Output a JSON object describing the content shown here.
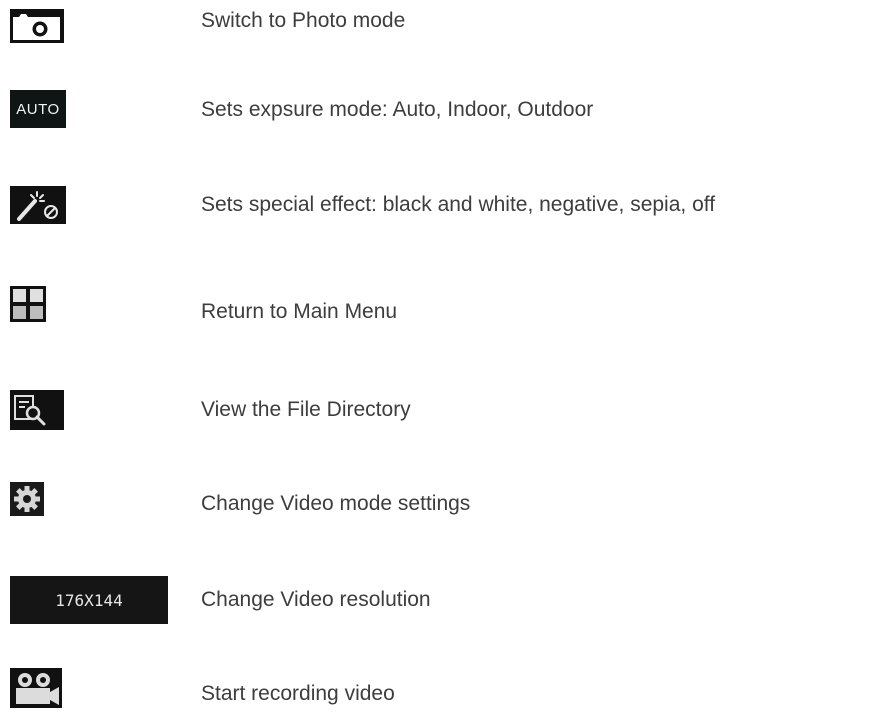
{
  "legend": {
    "items": [
      {
        "icon": "camera-icon",
        "label": "Switch to Photo mode"
      },
      {
        "icon": "auto-exposure-icon",
        "icon_text": "AUTO",
        "label": "Sets expsure mode:  Auto, Indoor, Outdoor"
      },
      {
        "icon": "magic-wand-effect-icon",
        "label": "Sets special effect:  black and white, negative, sepia, off"
      },
      {
        "icon": "grid-menu-icon",
        "label": "Return to Main Menu"
      },
      {
        "icon": "file-search-icon",
        "label": "View the File Directory"
      },
      {
        "icon": "gear-icon",
        "label": "Change Video mode settings"
      },
      {
        "icon": "resolution-icon",
        "icon_text": "176X144",
        "label": "Change Video resolution"
      },
      {
        "icon": "video-camera-icon",
        "label": "Start recording video"
      }
    ]
  },
  "colors": {
    "icon_background": "#111111",
    "text": "#3d3d3d"
  }
}
